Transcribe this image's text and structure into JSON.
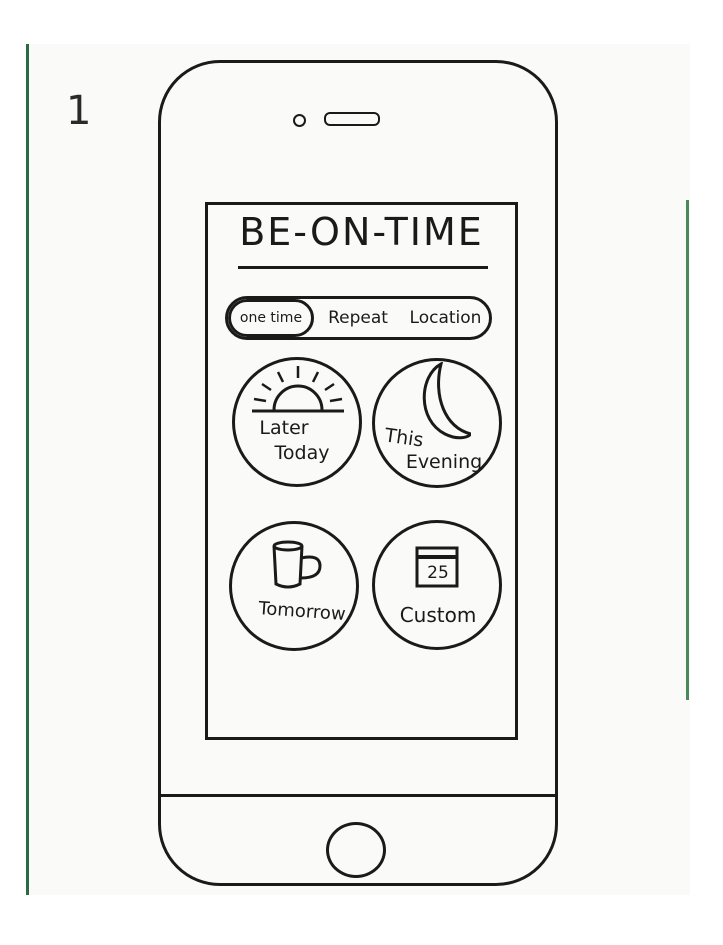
{
  "sketch": {
    "page_number": "1"
  },
  "app": {
    "title": "BE-ON-TIME"
  },
  "tabs": [
    {
      "label": "one time",
      "selected": true
    },
    {
      "label": "Repeat",
      "selected": false
    },
    {
      "label": "Location",
      "selected": false
    }
  ],
  "options": [
    {
      "line1": "Later",
      "line2": "Today",
      "icon": "sunrise-icon"
    },
    {
      "line1": "This",
      "line2": "Evening",
      "icon": "moon-icon"
    },
    {
      "line1": "Tomorrow",
      "line2": "",
      "icon": "coffee-mug-icon"
    },
    {
      "line1": "Custom",
      "line2": "",
      "icon": "calendar-icon",
      "calendar_day": "25"
    }
  ],
  "colors": {
    "ink": "#1a1a1a",
    "paper": "#fafaf8",
    "binding_edge": "#2a6a44"
  }
}
